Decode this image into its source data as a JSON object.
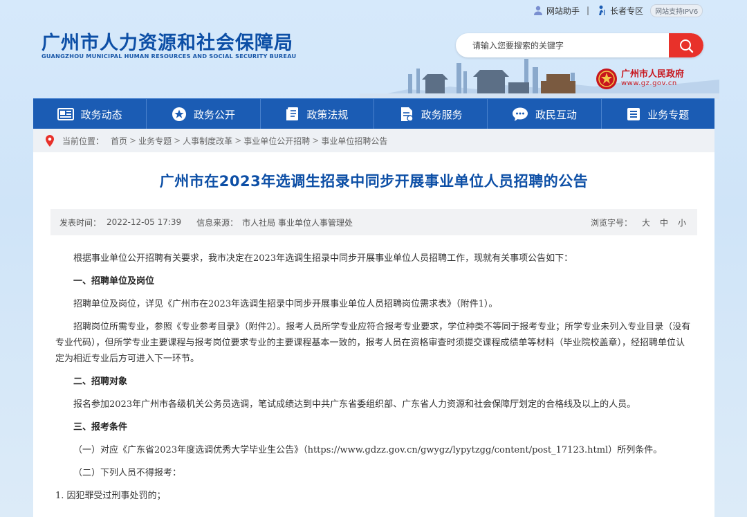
{
  "top_links": {
    "assistant": "网站助手",
    "separator": "|",
    "elder": "长者专区",
    "ipv6": "网站支持IPV6"
  },
  "site": {
    "title_cn": "广州市人力资源和社会保障局",
    "title_en": "GUANGZHOU MUNICIPAL HUMAN RESOURCES AND SOCIAL SECURITY BUREAU"
  },
  "search": {
    "placeholder": "请输入您要搜索的关键字"
  },
  "gov": {
    "name": "广州市人民政府",
    "url": "www.gz.gov.cn"
  },
  "nav": {
    "items": [
      {
        "label": "政务动态",
        "icon": "news-icon"
      },
      {
        "label": "政务公开",
        "icon": "star-icon"
      },
      {
        "label": "政策法规",
        "icon": "book-icon"
      },
      {
        "label": "政务服务",
        "icon": "document-icon"
      },
      {
        "label": "政民互动",
        "icon": "chat-icon"
      },
      {
        "label": "业务专题",
        "icon": "list-icon"
      }
    ]
  },
  "breadcrumb": {
    "prefix": "当前位置：",
    "arrow": ">",
    "items": [
      "首页",
      "业务专题",
      "人事制度改革",
      "事业单位公开招聘",
      "事业单位招聘公告"
    ]
  },
  "article": {
    "title": "广州市在2023年选调生招录中同步开展事业单位人员招聘的公告",
    "publish_label": "发表时间：",
    "publish_time": "2022-12-05 17:39",
    "source_label": "信息来源：",
    "source": "市人社局 事业单位人事管理处",
    "font_size_label": "浏览字号：",
    "font_sizes": [
      "大",
      "中",
      "小"
    ],
    "paragraphs": {
      "intro": "根据事业单位公开招聘有关要求，我市决定在2023年选调生招录中同步开展事业单位人员招聘工作，现就有关事项公告如下：",
      "h1": "一、招聘单位及岗位",
      "p1": "招聘单位及岗位，详见《广州市在2023年选调生招录中同步开展事业单位人员招聘岗位需求表》（附件1）。",
      "p2": "招聘岗位所需专业，参照《专业参考目录》（附件2）。报考人员所学专业应符合报考专业要求，学位种类不等同于报考专业；所学专业未列入专业目录（没有专业代码），但所学专业主要课程与报考岗位要求专业的主要课程基本一致的，报考人员在资格审查时须提交课程成绩单等材料（毕业院校盖章），经招聘单位认定为相近专业后方可进入下一环节。",
      "h2": "二、招聘对象",
      "p3": "报名参加2023年广州市各级机关公务员选调，笔试成绩达到中共广东省委组织部、广东省人力资源和社会保障厅划定的合格线及以上的人员。",
      "h3": "三、报考条件",
      "p4": "（一）对应《广东省2023年度选调优秀大学毕业生公告》（https://www.gdzz.gov.cn/gwygz/lypytzgg/content/post_17123.html）所列条件。",
      "p5": "（二）下列人员不得报考：",
      "p6": "1. 因犯罪受过刑事处罚的；"
    }
  },
  "colors": {
    "brand_blue": "#1b5cb4",
    "title_blue": "#0d4fa6",
    "search_red": "#e8312a",
    "gov_red": "#c8161d"
  }
}
